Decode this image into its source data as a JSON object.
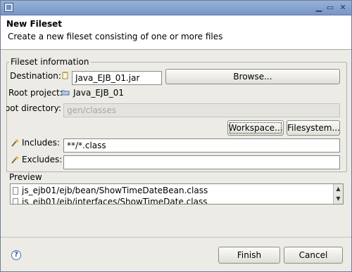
{
  "window": {
    "title": ""
  },
  "header": {
    "title": "New Fileset",
    "message": "Create a new fileset consisting of one or more files"
  },
  "fileset": {
    "group_label": "Fileset information",
    "destination_label": "Destination:",
    "destination_value": "Java_EJB_01.jar",
    "browse_label": "Browse...",
    "root_project_label": "Root project:",
    "root_project_value": "Java_EJB_01",
    "root_directory_label": "Root directory:",
    "root_directory_value": "gen/classes",
    "workspace_label": "Workspace...",
    "filesystem_label": "Filesystem...",
    "includes_label": "Includes:",
    "includes_value": "**/*.class",
    "excludes_label": "Excludes:",
    "excludes_value": ""
  },
  "preview": {
    "label": "Preview",
    "items": [
      "js_ejb01/ejb/bean/ShowTimeDateBean.class",
      "js_ejb01/ejb/interfaces/ShowTimeDate.class"
    ]
  },
  "footer": {
    "finish_label": "Finish",
    "cancel_label": "Cancel"
  }
}
